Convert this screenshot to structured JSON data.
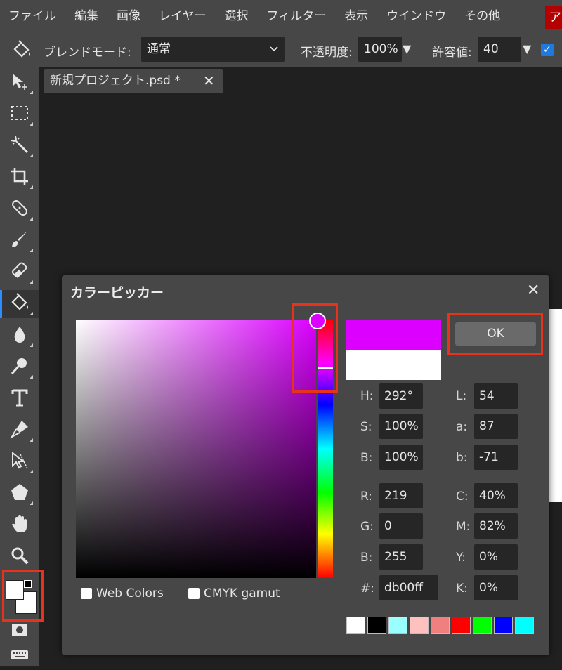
{
  "menu": {
    "items": [
      "ファイル",
      "編集",
      "画像",
      "レイヤー",
      "選択",
      "フィルター",
      "表示",
      "ウインドウ",
      "その他"
    ],
    "account_label": "ア"
  },
  "options": {
    "blend_label": "ブレンドモード:",
    "blend_value": "通常",
    "opacity_label": "不透明度:",
    "opacity_value": "100%",
    "tolerance_label": "許容値:",
    "tolerance_value": "40",
    "checkbox_checked": true
  },
  "document": {
    "tab_title": "新規プロジェクト.psd *",
    "close_symbol": "✕"
  },
  "toolbar": {
    "tools": [
      "move-tool",
      "marquee-tool",
      "magic-wand-tool",
      "crop-tool",
      "healing-tool",
      "brush-tool",
      "eraser-tool",
      "paint-bucket-tool",
      "blur-tool",
      "dodge-tool",
      "text-tool",
      "pen-tool",
      "path-select-tool",
      "shape-tool",
      "hand-tool",
      "zoom-tool"
    ],
    "active_tool": "paint-bucket-tool",
    "foreground_color": "#ffffff",
    "background_color": "#ffffff"
  },
  "color_picker": {
    "title": "カラーピッカー",
    "close_symbol": "✕",
    "ok_label": "OK",
    "new_color": "#db00ff",
    "old_color": "#ffffff",
    "web_colors_label": "Web Colors",
    "cmyk_gamut_label": "CMYK gamut",
    "fields": {
      "H": "292°",
      "S": "100%",
      "B": "100%",
      "R": "219",
      "G": "0",
      "B2": "255",
      "hex": "db00ff",
      "L": "54",
      "a": "87",
      "b": "-71",
      "C": "40%",
      "M": "82%",
      "Y": "0%",
      "K": "0%"
    },
    "labels": {
      "H": "H:",
      "S": "S:",
      "B": "B:",
      "R": "R:",
      "G": "G:",
      "B2": "B:",
      "hex": "#:",
      "L": "L:",
      "a": "a:",
      "b": "b:",
      "C": "C:",
      "M": "M:",
      "Y": "Y:",
      "K": "K:"
    },
    "presets": [
      "#ffffff",
      "#000000",
      "#99ffff",
      "#ffc0c0",
      "#f08080",
      "#ff0000",
      "#00ff00",
      "#0000ff",
      "#00ffff"
    ]
  }
}
